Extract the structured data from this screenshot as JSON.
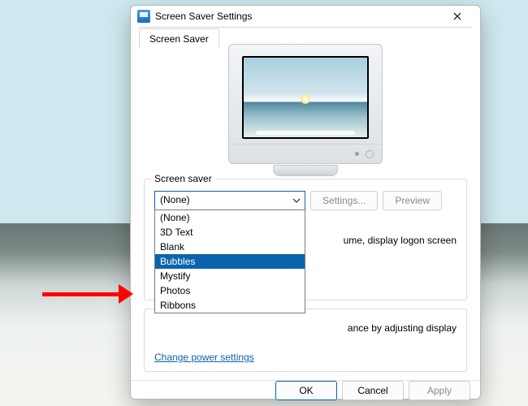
{
  "window": {
    "title": "Screen Saver Settings",
    "tab": "Screen Saver"
  },
  "group": {
    "legend": "Screen saver",
    "combo_value": "(None)",
    "settings_btn": "Settings...",
    "preview_btn": "Preview",
    "resume_fragment": "ume, display logon screen"
  },
  "options": [
    "(None)",
    "3D Text",
    "Blank",
    "Bubbles",
    "Mystify",
    "Photos",
    "Ribbons"
  ],
  "selected_option_index": 3,
  "power": {
    "pm_fragment": "ance by adjusting display",
    "link": "Change power settings"
  },
  "footer": {
    "ok": "OK",
    "cancel": "Cancel",
    "apply": "Apply"
  }
}
